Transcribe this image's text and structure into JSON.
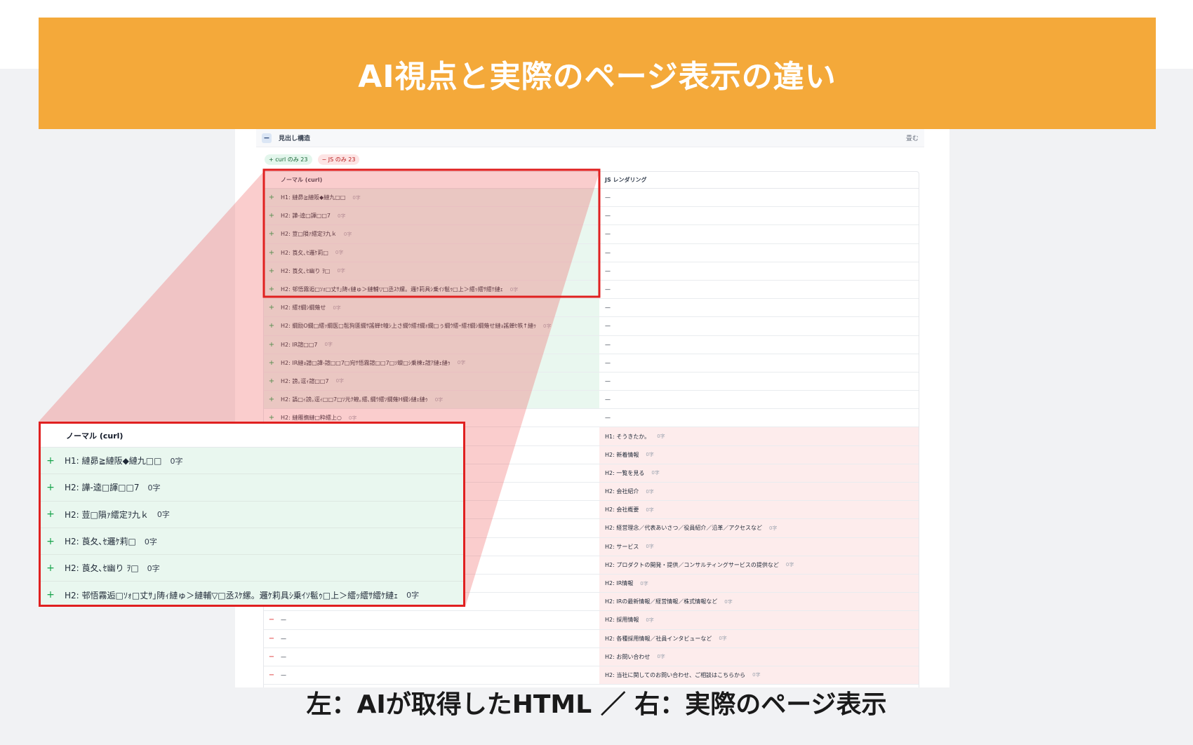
{
  "banner": {
    "title": "AI視点と実際のページ表示の違い"
  },
  "panel": {
    "title": "見出し構造",
    "collapse_label": "−",
    "fold_label": "畳む",
    "badges": {
      "curl_only": "+ curl のみ 23",
      "js_only": "− JS のみ 23"
    }
  },
  "table": {
    "left_header": "ノーマル (curl)",
    "right_header": "JS レンダリング",
    "count": "0字",
    "empty": "—",
    "left_rows": [
      "H1: 縺昴≧縺阪◆縺九□□",
      "H2: 譁-逵□諢□□7",
      "H2: 荳□隕ｧ繧定ｦ九ｋ",
      "H2: 莨夂､ｾ邏ｹ莉□",
      "H2: 莨夂､ｾ幽り ｦ□",
      "H2: 邨悟霧逅□ｿｫ□丈ｻ｣陦ｨ縺ゅ＞縺輔▽□丞ｽｹ縲。邏ｹ莉具ｼ乗ｲｿ髱ｩ□上＞繧ｯ繧ｻ繧ｹ縺ｪ",
      "H2: 繧ｵ繝ｼ繝薙せ",
      "H2: 繝励Ο繝□繧ｯ繝医□髢狗匱繝ｻ謠蝉ｾ幢ｼ上さ繝ｳ繧ｵ繝ｫ繝□ぅ繝ｳ繧ｰ繧ｵ繝ｼ繝薙せ縺ｮ謠蝉ｾ帙↑縺ｩ",
      "H2: IR諠□□7",
      "H2: IR縺ｮ譛□譁-諠□□7□宛ｻ悟霧諠□□7□ｿ蠑□ｼ乗棟ｪ諠ｱ縺ｪ縺ｩ",
      "H2: 謗｡逕ｨ諠□□7",
      "H2: 譌□ｨ謗｡逕ｨ□□7□ｿ元ｸ蝗｡繧､繝ｳ繧ｿ繝薙Η繝ｼ縺ｪ縺ｩ",
      "H2: 縺雁撫縺□粋繧上○"
    ],
    "right_rows": [
      "H1: そうきたか。",
      "H2: 新着情報",
      "H2: 一覧を見る",
      "H2: 会社紹介",
      "H2: 会社概要",
      "H2: 経営理念／代表あいさつ／役員紹介／沿革／アクセスなど",
      "H2: サービス",
      "H2: プロダクトの開発・提供／コンサルティングサービスの提供など",
      "H2: IR情報",
      "H2: IRの最新情報／経営情報／株式情報など",
      "H2: 採用情報",
      "H2: 各種採用情報／社員インタビューなど",
      "H2: お問い合わせ",
      "H2: 当社に関してのお問い合わせ、ご相談はこちらから"
    ]
  },
  "zoom": {
    "header": "ノーマル (curl)",
    "rows": [
      "H1: 縺昴≧縺阪◆縺九□□",
      "H2: 譁-逵□諢□□7",
      "H2: 荳□隕ｧ繧定ｦ九ｋ",
      "H2: 莨夂､ｾ邏ｹ莉□",
      "H2: 莨夂､ｾ幽り ｦ□",
      "H2: 邨悟霧逅□ｿｫ□丈ｻ｣陦ｨ縺ゅ＞縺輔▽□丞ｽｹ縲。邏ｹ莉具ｼ乗ｲｿ髱ｩ□上＞繧ｯ繧ｻ繧ｹ縺ｪ"
    ]
  },
  "caption": "左：AIが取得したHTML ／ 右：実際のページ表示",
  "colors": {
    "banner": "#f4a93a",
    "highlight": "#e02020",
    "curl_bg": "#e9f7ef",
    "js_bg": "#fdecec"
  }
}
